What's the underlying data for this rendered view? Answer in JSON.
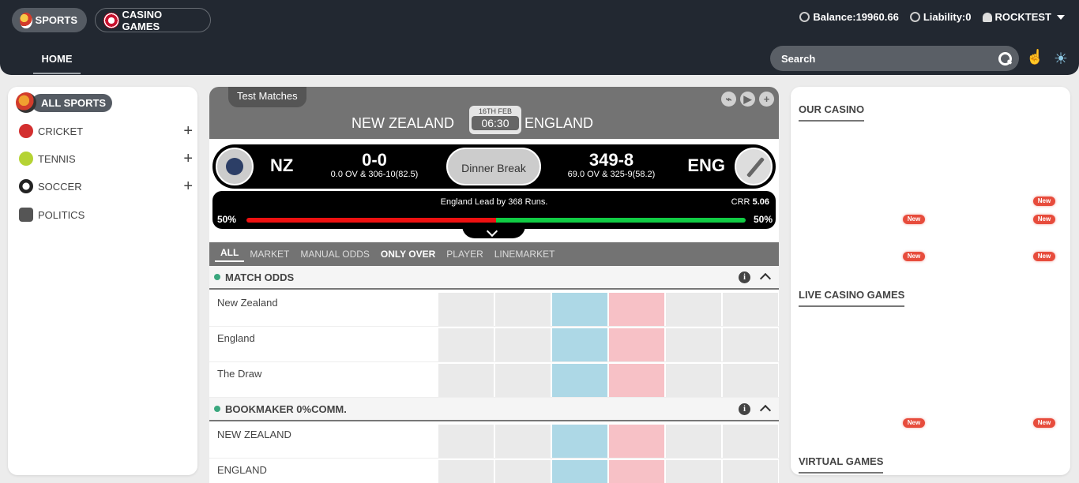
{
  "header": {
    "sports_label": "SPORTS",
    "casino_label": "CASINO GAMES",
    "balance": "Balance:19960.66",
    "liability": "Liability:0",
    "username": "ROCKTEST",
    "home_tab": "HOME",
    "search_placeholder": "Search"
  },
  "sidebar": {
    "all_label": "ALL SPORTS",
    "items": [
      {
        "label": "CRICKET",
        "icon": "cricket-ball-icon",
        "color": "#d32f2f"
      },
      {
        "label": "TENNIS",
        "icon": "tennis-ball-icon",
        "color": "#b5d334"
      },
      {
        "label": "SOCCER",
        "icon": "soccer-ball-icon",
        "color": "#222222"
      },
      {
        "label": "POLITICS",
        "icon": "politics-icon",
        "color": "#555555"
      }
    ]
  },
  "match": {
    "category": "Test Matches",
    "team_a": "NEW ZEALAND",
    "team_b": "ENGLAND",
    "date": "16TH FEB",
    "time": "06:30",
    "abbr_a": "NZ",
    "abbr_b": "ENG",
    "score_a": "0-0",
    "score_a_detail": "0.0 OV & 306-10(82.5)",
    "score_b": "349-8",
    "score_b_detail": "69.0 OV & 325-9(58.2)",
    "status": "Dinner Break",
    "lead_text": "England Lead by 368 Runs.",
    "crr_label": "CRR",
    "crr_value": "5.06",
    "pct_left": "50%",
    "pct_right": "50%",
    "progress_left_fraction": 0.5
  },
  "market_tabs": [
    "ALL",
    "MARKET",
    "MANUAL ODDS",
    "ONLY OVER",
    "PLAYER",
    "LINEMARKET"
  ],
  "markets": [
    {
      "name": "MATCH ODDS",
      "runners": [
        "New Zealand",
        "England",
        "The Draw"
      ]
    },
    {
      "name": "BOOKMAKER 0%COMM.",
      "runners": [
        "NEW ZEALAND",
        "ENGLAND"
      ]
    }
  ],
  "right": {
    "our_casino": "OUR CASINO",
    "live_casino": "LIVE CASINO GAMES",
    "virtual_games": "VIRTUAL GAMES",
    "new_badge": "New"
  },
  "colors": {
    "header_bg": "#222831",
    "back": "#add8e6",
    "lay": "#f7c1c6",
    "accent_green": "#3aa77e"
  }
}
